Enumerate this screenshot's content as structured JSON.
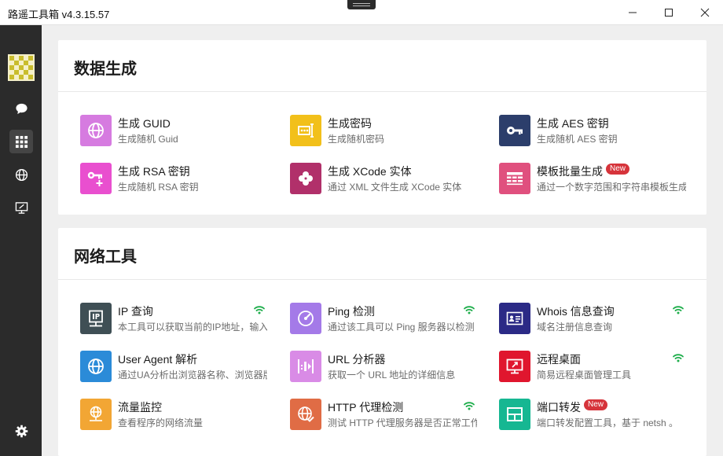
{
  "window": {
    "title": "路遥工具箱 v4.3.15.57"
  },
  "sidebar": {
    "items": [
      {
        "name": "chat",
        "icon": "chat-bubble-icon"
      },
      {
        "name": "apps",
        "icon": "grid-icon",
        "active": true
      },
      {
        "name": "network",
        "icon": "globe-icon"
      },
      {
        "name": "remote",
        "icon": "monitor-icon"
      }
    ],
    "settings_icon": "gear-icon"
  },
  "sections": [
    {
      "title": "数据生成",
      "tools": [
        {
          "name": "生成 GUID",
          "desc": "生成随机 Guid",
          "icon": "globe-icon",
          "color": "#d67be0"
        },
        {
          "name": "生成密码",
          "desc": "生成随机密码",
          "icon": "password-field-icon",
          "color": "#f2c01a"
        },
        {
          "name": "生成 AES 密钥",
          "desc": "生成随机 AES 密钥",
          "icon": "key-icon",
          "color": "#2c3e6b"
        },
        {
          "name": "生成 RSA 密钥",
          "desc": "生成随机 RSA 密钥",
          "icon": "key-plus-icon",
          "color": "#e94fcf"
        },
        {
          "name": "生成 XCode 实体",
          "desc": "通过 XML 文件生成 XCode 实体",
          "icon": "clover-icon",
          "color": "#b1306a"
        },
        {
          "name": "模板批量生成",
          "desc": "通过一个数字范围和字符串模板生成",
          "icon": "table-icon",
          "color": "#e0507e",
          "badge": "New"
        }
      ]
    },
    {
      "title": "网络工具",
      "tools": [
        {
          "name": "IP 查询",
          "desc": "本工具可以获取当前的IP地址，输入",
          "icon": "ip-icon",
          "color": "#3f4f55",
          "online": true
        },
        {
          "name": "Ping 检测",
          "desc": "通过该工具可以 Ping 服务器以检测",
          "icon": "gauge-icon",
          "color": "#a47ae8",
          "online": true
        },
        {
          "name": "Whois 信息查询",
          "desc": "域名注册信息查询",
          "icon": "id-card-icon",
          "color": "#2b2a86",
          "online": true
        },
        {
          "name": "User Agent 解析",
          "desc": "通过UA分析出浏览器名称、浏览器版",
          "icon": "globe-icon",
          "color": "#2b8bd8",
          "online": false
        },
        {
          "name": "URL 分析器",
          "desc": "获取一个 URL 地址的详细信息",
          "icon": "url-parse-icon",
          "color": "#d98be6",
          "online": false
        },
        {
          "name": "远程桌面",
          "desc": "简易远程桌面管理工具",
          "icon": "remote-desktop-icon",
          "color": "#e0162e",
          "online": true
        },
        {
          "name": "流量监控",
          "desc": "查看程序的网络流量",
          "icon": "network-globe-icon",
          "color": "#f2a634",
          "online": false
        },
        {
          "name": "HTTP 代理检测",
          "desc": "测试 HTTP 代理服务器是否正常工作",
          "icon": "globe-check-icon",
          "color": "#e06c45",
          "online": true
        },
        {
          "name": "端口转发",
          "desc": "端口转发配置工具，基于 netsh 。",
          "icon": "port-forward-icon",
          "color": "#16b792",
          "badge": "New",
          "online": false
        }
      ]
    }
  ],
  "accent": {
    "online": "#1fae4c",
    "badge": "#d6343b"
  }
}
